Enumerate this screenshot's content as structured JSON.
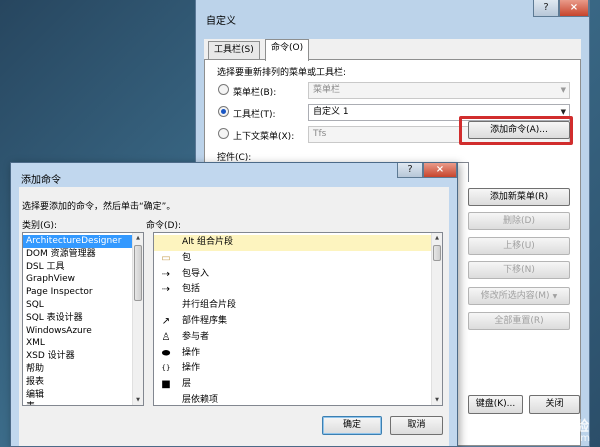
{
  "back_dialog": {
    "title": "自定义",
    "help_glyph": "?",
    "close_glyph": "×",
    "tabs": [
      {
        "label": "工具栏(S)",
        "active": false
      },
      {
        "label": "命令(O)",
        "active": true
      }
    ],
    "prompt": "选择要重新排列的菜单或工具栏:",
    "radios": [
      {
        "label": "菜单栏(B):",
        "checked": false,
        "combo_value": "菜单栏",
        "enabled": false
      },
      {
        "label": "工具栏(T):",
        "checked": true,
        "combo_value": "自定义 1",
        "enabled": true
      },
      {
        "label": "上下文菜单(X):",
        "checked": false,
        "combo_value": "Tfs",
        "enabled": false
      }
    ],
    "controls_label": "控件(C):",
    "buttons": [
      {
        "label": "添加命令(A)...",
        "enabled": true
      },
      {
        "label": "添加新菜单(R)",
        "enabled": true
      },
      {
        "label": "删除(D)",
        "enabled": false
      },
      {
        "label": "上移(U)",
        "enabled": false
      },
      {
        "label": "下移(N)",
        "enabled": false
      },
      {
        "label": "修改所选内容(M)",
        "enabled": false
      },
      {
        "label": "全部重置(R)",
        "enabled": false
      }
    ],
    "bottom_buttons": [
      {
        "label": "键盘(K)..."
      },
      {
        "label": "关闭"
      }
    ],
    "highlight_color": "#d12d2d"
  },
  "front_dialog": {
    "title": "添加命令",
    "help_glyph": "?",
    "close_glyph": "×",
    "instruction": "选择要添加的命令，然后单击“确定”。",
    "categories_label": "类别(G):",
    "commands_label": "命令(D):",
    "categories": [
      {
        "label": "ArchitectureDesigner",
        "selected": true
      },
      {
        "label": "DOM 资源管理器",
        "selected": false
      },
      {
        "label": "DSL 工具",
        "selected": false
      },
      {
        "label": "GraphView",
        "selected": false
      },
      {
        "label": "Page Inspector",
        "selected": false
      },
      {
        "label": "SQL",
        "selected": false
      },
      {
        "label": "SQL 表设计器",
        "selected": false
      },
      {
        "label": "WindowsAzure",
        "selected": false
      },
      {
        "label": "XML",
        "selected": false
      },
      {
        "label": "XSD 设计器",
        "selected": false
      },
      {
        "label": "帮助",
        "selected": false
      },
      {
        "label": "报表",
        "selected": false
      },
      {
        "label": "编辑",
        "selected": false
      },
      {
        "label": "表",
        "selected": false
      }
    ],
    "commands": [
      {
        "label": "Alt 组合片段",
        "icon": "none",
        "selected": true
      },
      {
        "label": "包",
        "icon": "folder-icon",
        "selected": false
      },
      {
        "label": "包导入",
        "icon": "dashed-arrow-icon",
        "selected": false
      },
      {
        "label": "包括",
        "icon": "dashed-arrow-icon",
        "selected": false
      },
      {
        "label": "并行组合片段",
        "icon": "none",
        "selected": false
      },
      {
        "label": "部件程序集",
        "icon": "arrow-icon",
        "selected": false
      },
      {
        "label": "参与者",
        "icon": "person-icon",
        "selected": false
      },
      {
        "label": "操作",
        "icon": "oval-icon",
        "selected": false
      },
      {
        "label": "操作",
        "icon": "braces-icon",
        "selected": false
      },
      {
        "label": "层",
        "icon": "square-icon",
        "selected": false
      },
      {
        "label": "层依赖项",
        "icon": "none",
        "selected": false
      }
    ],
    "ok_label": "确定",
    "cancel_label": "取消"
  },
  "watermark": {
    "brand": "Bai度经验",
    "url": "jingyan.baidu.com"
  }
}
